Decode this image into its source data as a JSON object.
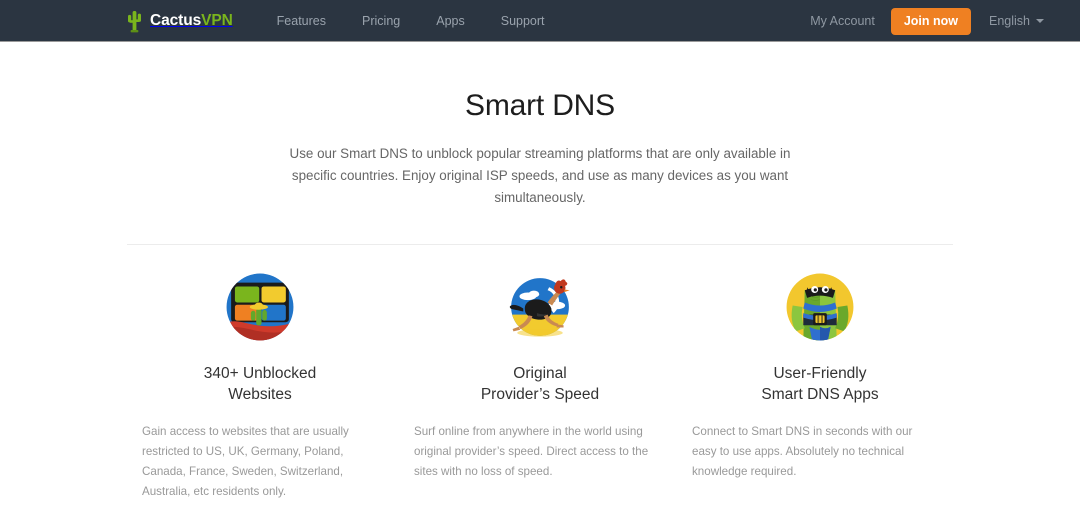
{
  "colors": {
    "navbar_bg": "#2b3541",
    "brand_green": "#7ab51d",
    "accent_orange": "#ef8022",
    "heading": "#1d1d1d",
    "body_text": "#666666",
    "muted_text": "#999999",
    "divider": "#ececec"
  },
  "navbar": {
    "logo": {
      "icon": "cactus-icon",
      "text_primary": "Cactus",
      "text_secondary": "VPN"
    },
    "links": [
      {
        "label": "Features"
      },
      {
        "label": "Pricing"
      },
      {
        "label": "Apps"
      },
      {
        "label": "Support"
      }
    ],
    "my_account_label": "My Account",
    "join_now_label": "Join now",
    "language_label": "English",
    "language_caret_icon": "chevron-down-icon"
  },
  "hero": {
    "title": "Smart DNS",
    "subtitle": "Use our Smart DNS to unblock popular streaming platforms that are only available in specific countries. Enjoy original ISP speeds, and use as many devices as you want simultaneously."
  },
  "features": [
    {
      "icon": "unblocked-websites-screens-cactus-icon",
      "title": "340+ Unblocked\nWebsites",
      "description": "Gain access to websites that are usually restricted to US, UK, Germany, Poland, Canada, France, Sweden, Switzerland, Australia, etc residents only."
    },
    {
      "icon": "running-ostrich-speed-icon",
      "title": "Original\nProvider’s Speed",
      "description": "Surf online from anywhere in the world using original provider’s speed. Direct access to the sites with no loss of speed."
    },
    {
      "icon": "cactus-superhero-apps-icon",
      "title": "User-Friendly\nSmart DNS Apps",
      "description": "Connect to Smart DNS in seconds with our easy to use apps. Absolutely no technical knowledge required."
    }
  ]
}
